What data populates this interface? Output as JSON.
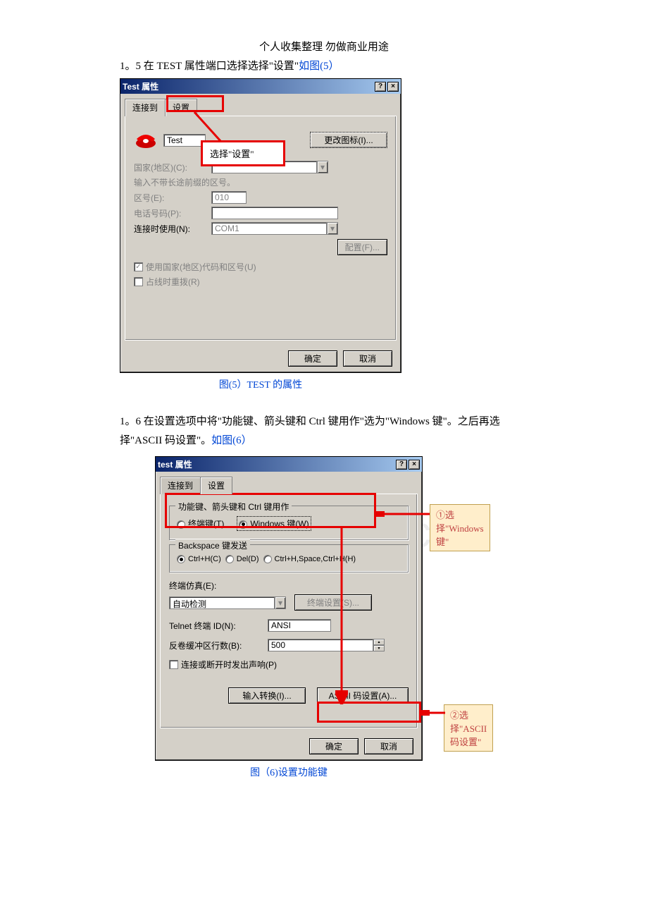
{
  "header_note": "个人收集整理 勿做商业用途",
  "step1": {
    "prefix": "1。5 在 TEST 属性端口选择选择\"设置\"",
    "link": "如图(5）"
  },
  "dialog1": {
    "title": "Test 属性",
    "tab_connect": "连接到",
    "tab_settings": "设置",
    "name_value": "Test",
    "change_icon_btn": "更改图标(I)...",
    "country_label": "国家(地区)(C):",
    "country_hint": "输入不带长途前缀的区号。",
    "area_label": "区号(E):",
    "area_value": "010",
    "phone_label": "电话号码(P):",
    "connect_label": "连接时使用(N):",
    "connect_value": "COM1",
    "config_btn": "配置(F)...",
    "use_country": "使用国家(地区)代码和区号(U)",
    "redial": "占线时重拨(R)",
    "ok": "确定",
    "cancel": "取消",
    "callout": "选择\"设置\""
  },
  "caption1": "图(5）TEST 的属性",
  "step2": {
    "line1a": "1。6 在设置选项中将\"功能键、箭头键和 Ctrl 键用作\"选为\"Windows 键\"。之后再选",
    "line1b": "择\"ASCII 码设置\"。",
    "link": "如图(6）"
  },
  "dialog2": {
    "title": "test 属性",
    "tab_connect": "连接到",
    "tab_settings": "设置",
    "group_func": "功能键、箭头键和 Ctrl 键用作",
    "radio_terminal": "终端键(T)",
    "radio_windows": "Windows 键(W)",
    "group_backspace": "Backspace 键发送",
    "bs_opt1": "Ctrl+H(C)",
    "bs_opt2": "Del(D)",
    "bs_opt3": "Ctrl+H,Space,Ctrl+H(H)",
    "emu_label": "终端仿真(E):",
    "emu_value": "自动检测",
    "term_setup_btn": "终端设置(S)...",
    "telnet_label": "Telnet 终端 ID(N):",
    "telnet_value": "ANSI",
    "buffer_label": "反卷缓冲区行数(B):",
    "buffer_value": "500",
    "beep_label": "连接或断开时发出声响(P)",
    "input_trans_btn": "输入转换(I)...",
    "ascii_btn": "ASCII 码设置(A)...",
    "ok": "确定",
    "cancel": "取消",
    "callout1": "①选择\"Windows 键\"",
    "callout2": "②选择\"ASCII 码设置\""
  },
  "caption2": "图（6)设置功能键",
  "watermark": "zixin.com.cn"
}
